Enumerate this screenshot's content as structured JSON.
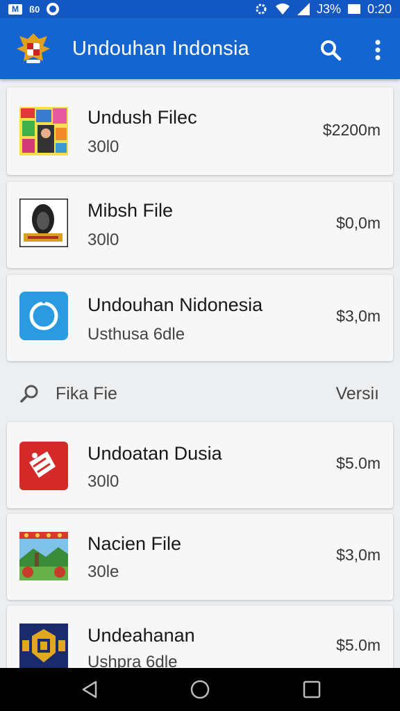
{
  "status_bar": {
    "left_text": "ß0",
    "battery": "J3%",
    "time": "0:20"
  },
  "app_bar": {
    "title": "Undouhan Indonsia",
    "search_icon": "search-icon",
    "more_icon": "more-vert-icon"
  },
  "items_top": [
    {
      "title": "Undush Filec",
      "subtitle": "30l0",
      "price": "$2200m",
      "icon": "collage-thumbnail"
    },
    {
      "title": "Mibsh File",
      "subtitle": "30l0",
      "price": "$0,0m",
      "icon": "portrait-thumbnail"
    },
    {
      "title": "Undouhan Nidonesia",
      "subtitle": "Usthusa 6dle",
      "price": "$3,0m",
      "icon": "circle-app-icon"
    }
  ],
  "section": {
    "label": "Fika Fie",
    "right": "Versiı"
  },
  "items_bottom": [
    {
      "title": "Undoatan Dusia",
      "subtitle": "30l0",
      "price": "$5.0m",
      "icon": "red-app-icon"
    },
    {
      "title": "Nacien File",
      "subtitle": "30le",
      "price": "$3,0m",
      "icon": "landscape-thumbnail"
    },
    {
      "title": "Undeahanan",
      "subtitle": "Ushpra 6dle",
      "price": "$5.0m",
      "icon": "badge-thumbnail"
    }
  ],
  "colors": {
    "app_bar": "#1565d0",
    "status_bar": "#1357c2",
    "accent_blue": "#2a9be0",
    "accent_red": "#d42a2a"
  }
}
